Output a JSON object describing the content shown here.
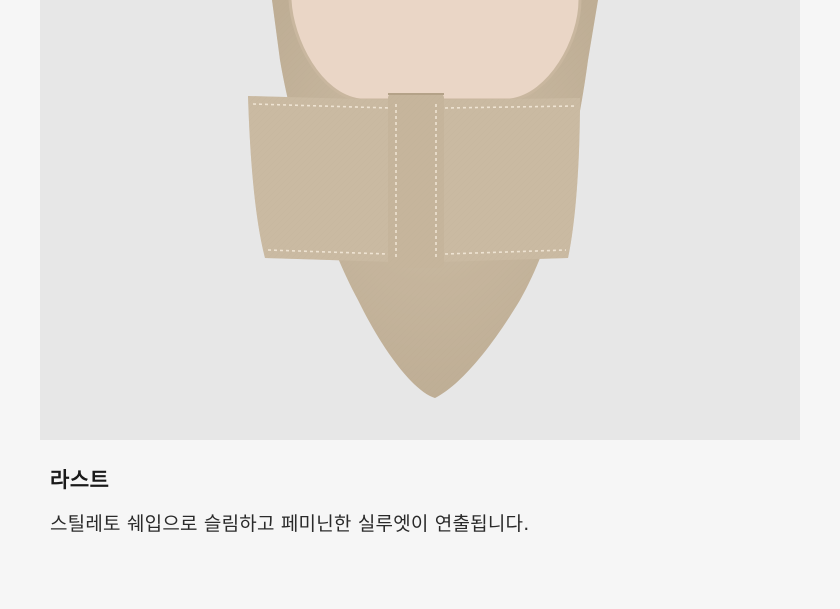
{
  "product_detail": {
    "image": {
      "subject": "shoe-bow-detail",
      "colors": {
        "background": "#e7e7e7",
        "suede": "#cbbba3",
        "suede_shadow": "#b9a88f",
        "insole": "#ead6c6",
        "stitch": "#eee3d2"
      }
    },
    "feature_title": "라스트",
    "feature_description": "스틸레토 쉐입으로 슬림하고 페미닌한 실루엣이 연출됩니다."
  }
}
